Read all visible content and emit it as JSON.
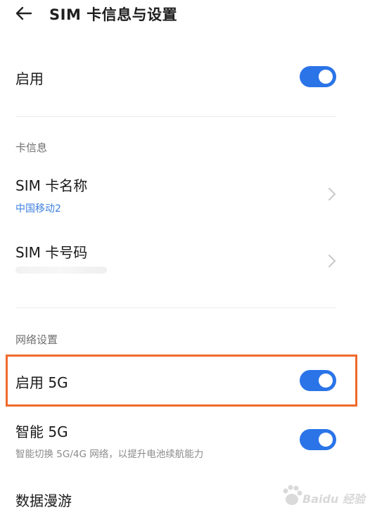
{
  "header": {
    "title": "SIM 卡信息与设置"
  },
  "enable": {
    "label": "启用",
    "on": true
  },
  "card_info": {
    "section_title": "卡信息",
    "sim_name": {
      "label": "SIM 卡名称",
      "value": "中国移动2"
    },
    "sim_number": {
      "label": "SIM 卡号码"
    }
  },
  "network": {
    "section_title": "网络设置",
    "enable_5g": {
      "label": "启用 5G",
      "on": true
    },
    "smart_5g": {
      "label": "智能 5G",
      "desc": "智能切换 5G/4G 网络，以提升电池续航能力",
      "on": true
    },
    "data_roaming": {
      "label": "数据漫游"
    }
  },
  "watermark": {
    "text": "Baidu 经验"
  },
  "colors": {
    "accent": "#2a74e8",
    "highlight": "#f06a2c",
    "link": "#3b7ee0"
  }
}
